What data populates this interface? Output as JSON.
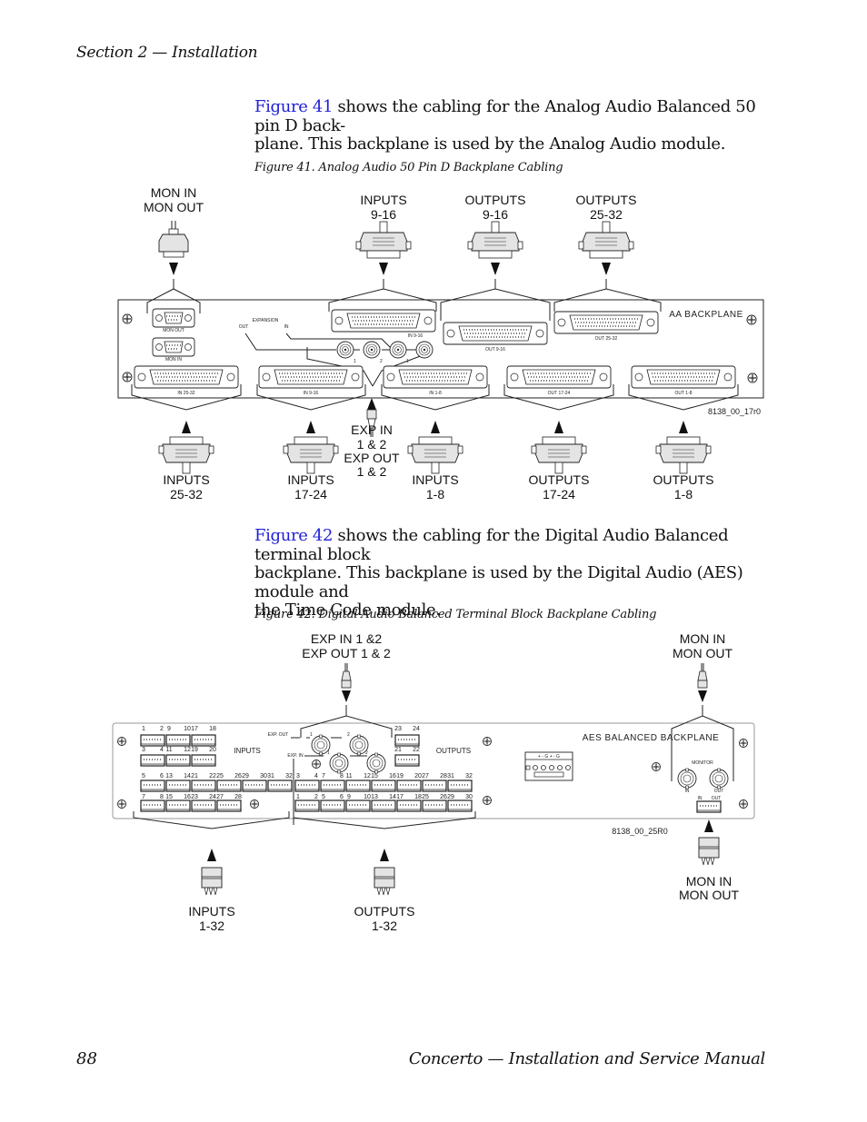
{
  "header": {
    "section": "Section 2 — Installation"
  },
  "paragraph1": {
    "link": "Figure 41",
    "line1_rest": " shows the cabling for the Analog Audio Balanced 50 pin D back-",
    "line2": "plane. This backplane is used by the Analog Audio module."
  },
  "figure41": {
    "caption": "Figure 41.  Analog Audio 50 Pin D  Backplane Cabling",
    "panel_label": "AA BACKPLANE",
    "drawing_id": "8138_00_17r0",
    "top_callouts": [
      {
        "line1": "MON IN",
        "line2": "MON OUT"
      },
      {
        "line1": "INPUTS",
        "line2": "9-16"
      },
      {
        "line1": "OUTPUTS",
        "line2": "9-16"
      },
      {
        "line1": "OUTPUTS",
        "line2": "25-32"
      }
    ],
    "bottom_callouts": [
      {
        "line1": "INPUTS",
        "line2": "25-32"
      },
      {
        "line1": "INPUTS",
        "line2": "17-24"
      },
      {
        "line1": "INPUTS",
        "line2": "1-8"
      },
      {
        "line1": "OUTPUTS",
        "line2": "17-24"
      },
      {
        "line1": "OUTPUTS",
        "line2": "1-8"
      }
    ],
    "exp_callout": [
      "EXP IN",
      "1 & 2",
      "EXP OUT",
      "1 & 2"
    ],
    "connector_labels": {
      "mon_out": "MON OUT",
      "mon_in": "MON IN",
      "expansion": "EXPANSION",
      "out": "OUT",
      "in": "IN",
      "in_9_16": "IN 9-16",
      "out_9_16": "OUT 9-16",
      "out_25_32": "OUT 25-32",
      "in_25_32": "IN 25-32",
      "in_17_24": "IN 9-16",
      "in_1_8": "IN 1-8",
      "out_17_24": "OUT 17-24",
      "out_1_8": "OUT 1-8",
      "bnc1": "1",
      "bnc2": "2"
    }
  },
  "paragraph2": {
    "link": "Figure 42",
    "line1_rest": " shows the cabling for the Digital Audio Balanced terminal block",
    "line2": "backplane. This backplane is used by the Digital Audio (AES) module and",
    "line3": "the Time Code module."
  },
  "figure42": {
    "caption": "Figure 42.  Digital Audio Balanced Terminal Block Backplane Cabling",
    "panel_label": "AES BALANCED BACKPLANE",
    "drawing_id": "8138_00_25R0",
    "top_callouts": [
      {
        "line1": "EXP IN 1 &2",
        "line2": "EXP OUT 1 & 2"
      },
      {
        "line1": "MON IN",
        "line2": "MON OUT"
      }
    ],
    "bottom_callouts": [
      {
        "line1": "INPUTS",
        "line2": "1-32"
      },
      {
        "line1": "OUTPUTS",
        "line2": "1-32"
      },
      {
        "line1": "MON IN",
        "line2": "MON OUT"
      }
    ],
    "labels": {
      "inputs": "INPUTS",
      "outputs": "OUTPUTS",
      "exp_out": "EXP. OUT",
      "exp_in": "EXP. IN",
      "monitor": "MONITOR",
      "in": "IN",
      "out": "OUT",
      "tb_pins": "+  -  G  +  -  G"
    },
    "input_row1_nums": [
      "1",
      "2",
      "9",
      "10",
      "17",
      "18"
    ],
    "input_row2_nums": [
      "3",
      "4",
      "11",
      "12",
      "19",
      "20"
    ],
    "input_row3_nums": [
      "5",
      "6",
      "13",
      "14",
      "21",
      "22",
      "25",
      "26",
      "29",
      "30",
      "31",
      "32"
    ],
    "input_row4_nums": [
      "7",
      "8",
      "15",
      "16",
      "23",
      "24",
      "27",
      "28"
    ],
    "output_top_nums": [
      "23",
      "24",
      "21",
      "22"
    ],
    "output_row3_nums": [
      "3",
      "4",
      "7",
      "8",
      "11",
      "12",
      "15",
      "16",
      "19",
      "20",
      "27",
      "28",
      "31",
      "32"
    ],
    "output_row4_nums": [
      "1",
      "2",
      "5",
      "6",
      "9",
      "10",
      "13",
      "14",
      "17",
      "18",
      "25",
      "26",
      "29",
      "30"
    ],
    "bnc1": "1",
    "bnc2": "2"
  },
  "footer": {
    "page_number": "88",
    "title": "Concerto  —  Installation and Service Manual"
  }
}
